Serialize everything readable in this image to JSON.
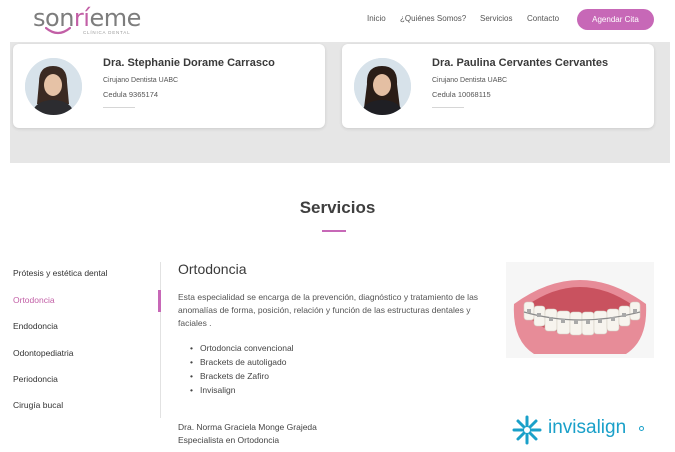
{
  "header": {
    "logo_text_a": "son",
    "logo_text_b": "rí",
    "logo_text_c": "eme",
    "logo_subtitle": "CLÍNICA DENTAL",
    "nav": [
      "Inicio",
      "¿Quiénes Somos?",
      "Servicios",
      "Contacto"
    ],
    "cta_label": "Agendar Cita"
  },
  "doctors": [
    {
      "name": "Dra. Stephanie Dorame Carrasco",
      "title": "Cirujano Dentista UABC",
      "cedula": "Cedula 9365174"
    },
    {
      "name": "Dra. Paulina Cervantes Cervantes",
      "title": "Cirujano Dentista UABC",
      "cedula": "Cedula 10068115"
    }
  ],
  "services": {
    "title": "Servicios",
    "menu": [
      "Prótesis y estética dental",
      "Ortodoncia",
      "Endodoncia",
      "Odontopediatria",
      "Periodoncia",
      "Cirugía bucal"
    ],
    "active_index": 1,
    "detail": {
      "title": "Ortodoncia",
      "description": "Esta especialidad se encarga de la prevención, diagnóstico y tratamiento de las anomalías de forma, posición, relación y función de las estructuras dentales y faciales .",
      "items": [
        "Ortodoncia convencional",
        "Brackets de autoligado",
        "Brackets de Zafiro",
        "Invisalign"
      ],
      "doctor_name": "Dra. Norma Graciela Monge Grajeda",
      "doctor_role": "Especialista en Ortodoncia"
    },
    "brand_logo": "invisalign"
  },
  "colors": {
    "accent": "#c768b7",
    "invisalign_blue": "#1aa0c9",
    "band_bg": "#e6e6e6"
  },
  "icons": {
    "logo_smile": "smile-icon",
    "invisalign_star": "invisalign-star-icon"
  }
}
